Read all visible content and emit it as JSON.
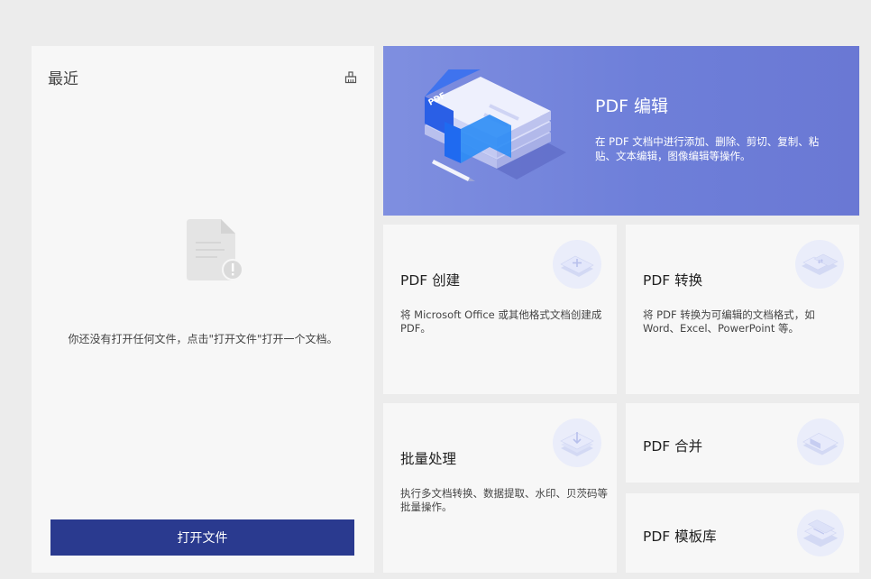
{
  "recent": {
    "title": "最近",
    "empty_message": "你还没有打开任何文件，点击\"打开文件\"打开一个文档。",
    "open_button": "打开文件"
  },
  "banner": {
    "title": "PDF 编辑",
    "description": "在 PDF 文档中进行添加、删除、剪切、复制、粘贴、文本编辑，图像编辑等操作。",
    "illustration_badge": "PDF"
  },
  "cards": {
    "create": {
      "title": "PDF 创建",
      "description": "将 Microsoft Office 或其他格式文档创建成PDF。"
    },
    "convert": {
      "title": "PDF 转换",
      "description": "将 PDF 转换为可编辑的文档格式，如 Word、Excel、PowerPoint 等。"
    },
    "batch": {
      "title": "批量处理",
      "description": "执行多文档转换、数据提取、水印、贝茨码等批量操作。"
    },
    "merge": {
      "title": "PDF 合并"
    },
    "templates": {
      "title": "PDF 模板库"
    }
  },
  "colors": {
    "open_button": "#2a3a8f",
    "banner": "#7283db",
    "card_bg": "#f7f7f7",
    "page_bg": "#ececec"
  }
}
